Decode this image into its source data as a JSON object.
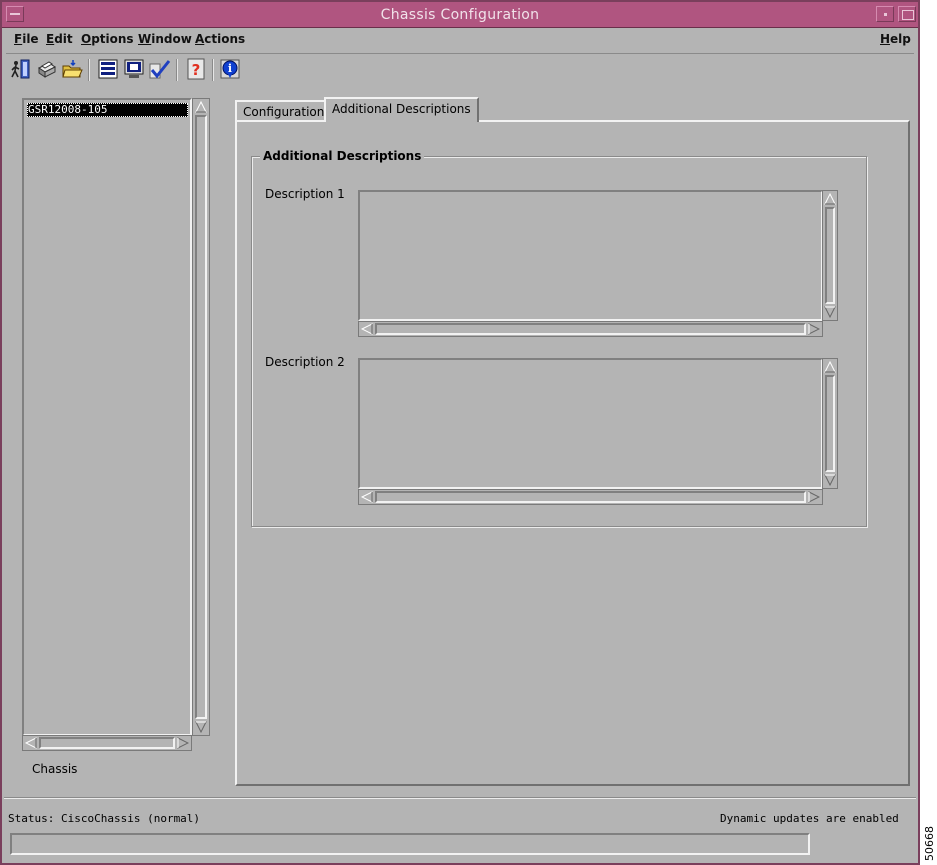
{
  "window": {
    "title": "Chassis Configuration"
  },
  "menubar": {
    "items": [
      {
        "label": "File",
        "mnemonic": "F"
      },
      {
        "label": "Edit",
        "mnemonic": "E"
      },
      {
        "label": "Options",
        "mnemonic": "O"
      },
      {
        "label": "Window",
        "mnemonic": "W"
      },
      {
        "label": "Actions",
        "mnemonic": "A"
      }
    ],
    "help": {
      "label": "Help",
      "mnemonic": "H"
    }
  },
  "toolbar": {
    "icons": [
      "exit-icon",
      "print-icon",
      "open-folder-icon",
      "list-icon",
      "monitor-icon",
      "check-icon",
      "help-icon",
      "info-icon"
    ]
  },
  "tree": {
    "items": [
      {
        "label": "GSR12008-105",
        "selected": true
      }
    ],
    "label": "Chassis"
  },
  "tabs": [
    {
      "label": "Configuration",
      "active": false
    },
    {
      "label": "Additional Descriptions",
      "active": true
    }
  ],
  "group": {
    "title": "Additional Descriptions",
    "fields": [
      {
        "label": "Description 1",
        "value": ""
      },
      {
        "label": "Description 2",
        "value": ""
      }
    ]
  },
  "status": {
    "text": "Status: CiscoChassis (normal)",
    "dynamic": "Dynamic updates are enabled",
    "message": ""
  },
  "figure_id": "50668",
  "colors": {
    "titlebar": "#b05580",
    "background": "#b4b4b4",
    "selection": "#000000"
  }
}
